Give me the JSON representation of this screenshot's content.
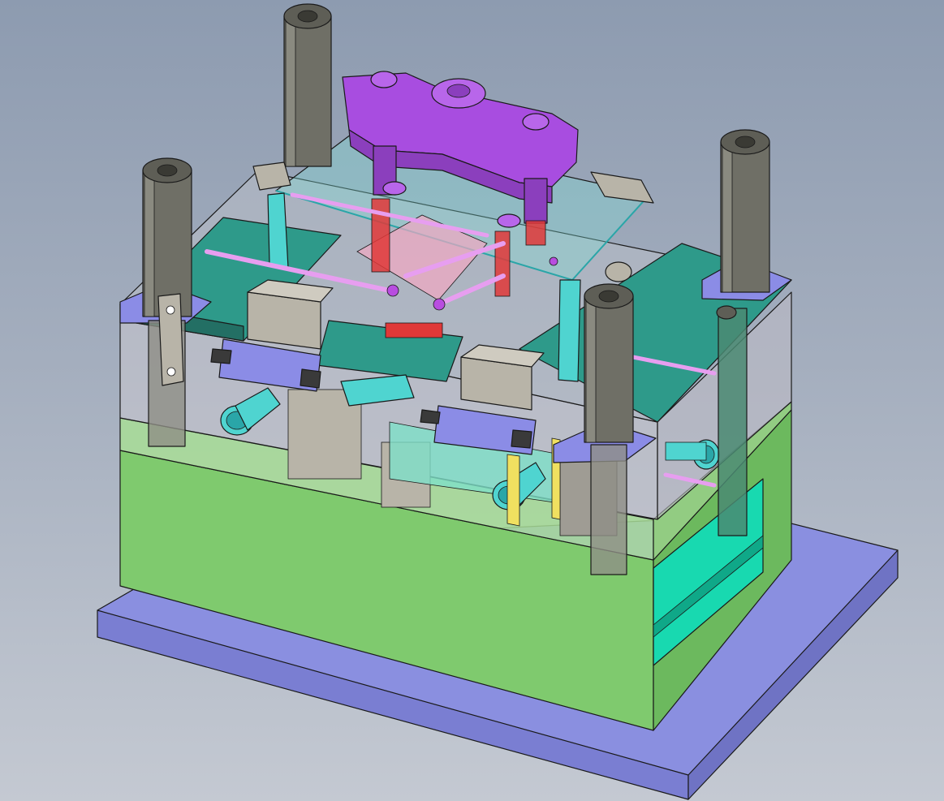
{
  "viewport": {
    "background_top": "#8d9bb0",
    "background_bottom": "#c4c9d2"
  },
  "colors": {
    "base_plate": "#8a8fe0",
    "base_plate_dark": "#6f73c4",
    "cavity_plate": "#7fca6e",
    "cavity_plate_light": "#a8dd97",
    "ejector_side": "#18d9b0",
    "top_plate": "#2e9a8a",
    "guide_pillar": "#6f6f66",
    "guide_bushing": "#8b8ce6",
    "sprue_bar": "#a84de0",
    "cooling_channel": "#e79ef0",
    "core_insert": "#4fd4d0",
    "highlight_red": "#e03838",
    "pink_channel": "#f2a8c2",
    "slider_block": "#b8b4a8"
  },
  "model": {
    "parts": [
      "base-plate",
      "cavity-plate",
      "ejector-side-plate",
      "top-plate",
      "guide-pillar",
      "sprue-bar",
      "slider-block",
      "core-insert",
      "cooling-channel",
      "guide-bushing"
    ]
  }
}
